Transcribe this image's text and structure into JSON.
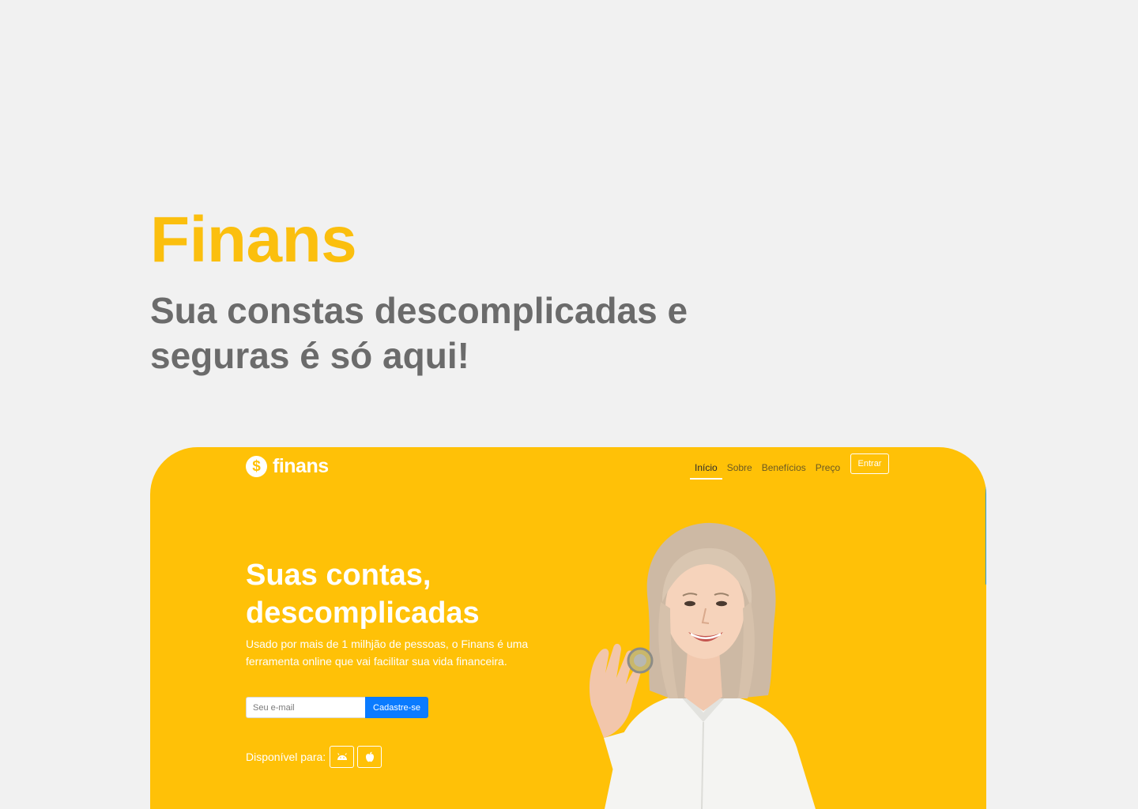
{
  "showcase": {
    "title": "Finans",
    "subtitle": "Sua constas descomplicadas e seguras é só aqui!"
  },
  "colors": {
    "accent": "#fbbf0e",
    "card_background": "#ffc107",
    "primary_button": "#0a7bff",
    "subtitle": "#6b6b6b"
  },
  "preview": {
    "logo": {
      "icon": "dollar-coin-icon",
      "glyph": "$",
      "text": "finans"
    },
    "nav": {
      "items": [
        {
          "label": "Início",
          "active": true
        },
        {
          "label": "Sobre",
          "active": false
        },
        {
          "label": "Benefícios",
          "active": false
        },
        {
          "label": "Preço",
          "active": false
        }
      ],
      "login_label": "Entrar"
    },
    "hero": {
      "title": "Suas contas, descomplicadas",
      "description": "Usado por mais de 1 milhjão de pessoas, o Finans é uma ferramenta online que vai facilitar sua vida financeira.",
      "email_placeholder": "Seu e-mail",
      "email_value": "",
      "signup_label": "Cadastre-se",
      "available_label": "Disponível para:",
      "stores": [
        "android-icon",
        "apple-icon"
      ]
    }
  }
}
